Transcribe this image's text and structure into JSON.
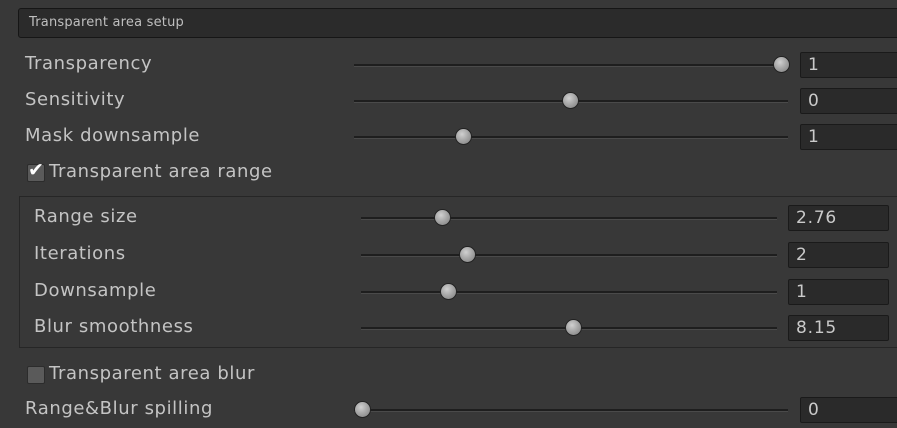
{
  "header": {
    "title": "Transparent area setup"
  },
  "rows": {
    "transparency": {
      "label": "Transparency",
      "value": "1",
      "level": 1.0
    },
    "sensitivity": {
      "label": "Sensitivity",
      "value": "0",
      "level": 0.5
    },
    "mask_downsample": {
      "label": "Mask downsample",
      "value": "1",
      "level": 0.25
    }
  },
  "range_toggle": {
    "label": "Transparent area range",
    "checked": true
  },
  "range_group": {
    "range_size": {
      "label": "Range size",
      "value": "2.76",
      "level": 0.2
    },
    "iterations": {
      "label": "Iterations",
      "value": "2",
      "level": 0.25
    },
    "downsample": {
      "label": "Downsample",
      "value": "1",
      "level": 0.21
    },
    "blur_smoothness": {
      "label": "Blur smoothness",
      "value": "8.15",
      "level": 0.51
    }
  },
  "blur_toggle": {
    "label": "Transparent area blur",
    "checked": false
  },
  "spilling": {
    "label": "Range&Blur spilling",
    "value": "0",
    "level": 0.0
  },
  "colors": {
    "background": "#383838",
    "field": "#2a2a2a",
    "text": "#c4c4c4"
  }
}
